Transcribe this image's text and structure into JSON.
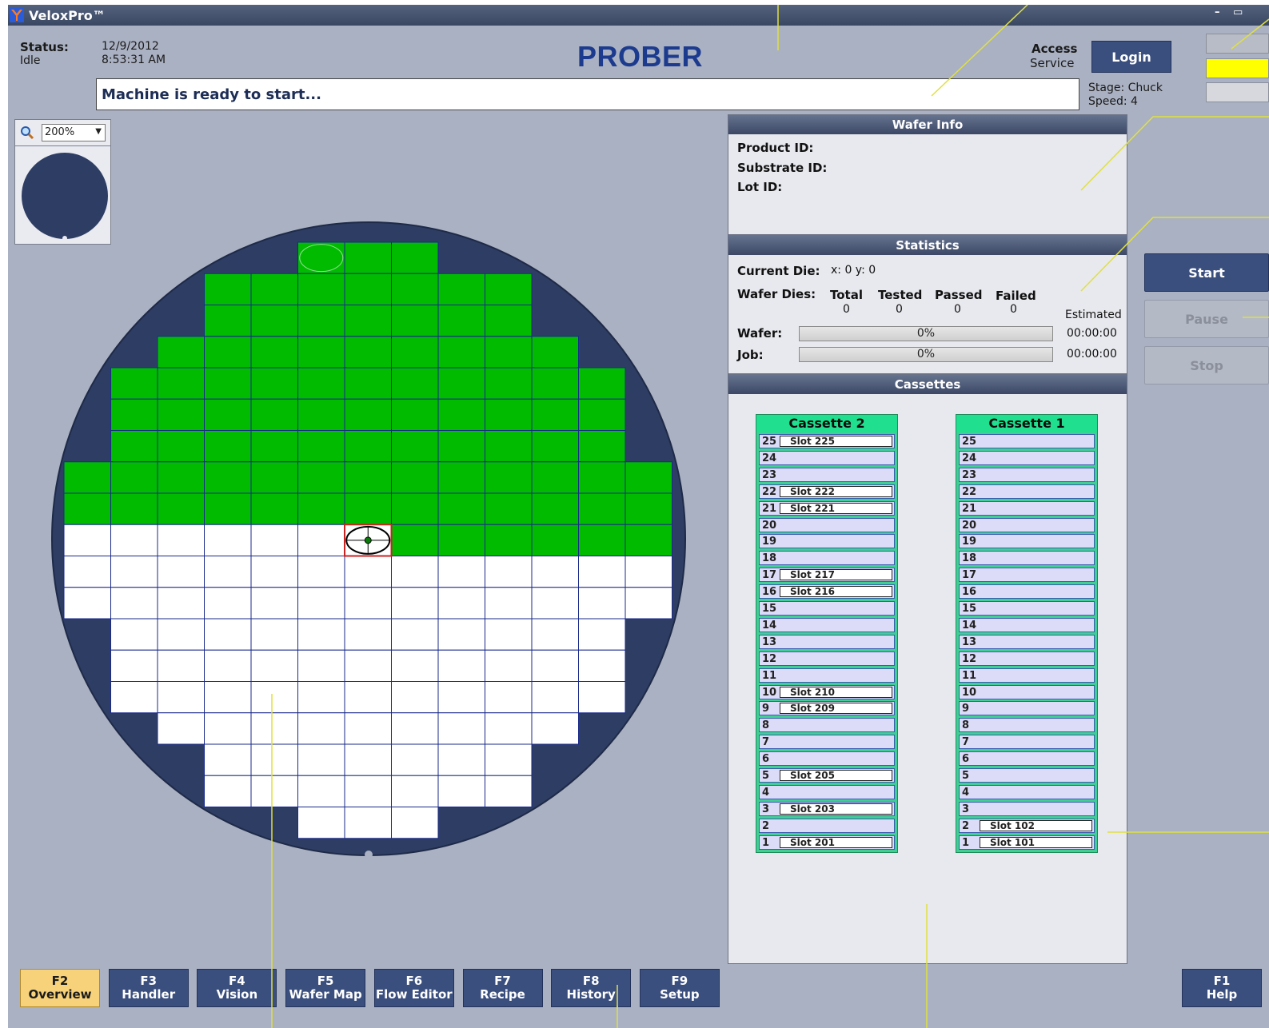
{
  "window": {
    "title": "VeloxPro™"
  },
  "header": {
    "status_label": "Status:",
    "status_value": "Idle",
    "date": "12/9/2012",
    "time": "8:53:31 AM",
    "app_heading": "PROBER",
    "access_label": "Access",
    "access_value": "Service",
    "login_label": "Login",
    "message": "Machine is ready to start...",
    "stage": "Stage: Chuck",
    "speed": "Speed: 4"
  },
  "indicators": [
    {
      "color": "#b8bcc6"
    },
    {
      "color": "#ffff00"
    },
    {
      "color": "#d6d8de"
    }
  ],
  "zoom": {
    "value": "200%"
  },
  "wafer_map": {
    "colors": {
      "wafer": "#2e3d63",
      "tested": "#00bb00",
      "untested": "#ffffff",
      "grid": "#1a2a8a",
      "current": "#cc2222"
    },
    "rows": [
      {
        "from": 5,
        "to": 7,
        "tested": [
          5,
          7
        ]
      },
      {
        "from": 3,
        "to": 9,
        "tested": [
          3,
          9
        ]
      },
      {
        "from": 3,
        "to": 9,
        "tested": [
          3,
          9
        ]
      },
      {
        "from": 2,
        "to": 10,
        "tested": [
          2,
          10
        ]
      },
      {
        "from": 1,
        "to": 11,
        "tested": [
          1,
          11
        ]
      },
      {
        "from": 1,
        "to": 11,
        "tested": [
          1,
          11
        ]
      },
      {
        "from": 1,
        "to": 11,
        "tested": [
          1,
          11
        ]
      },
      {
        "from": 0,
        "to": 12,
        "tested": [
          0,
          12
        ]
      },
      {
        "from": 0,
        "to": 12,
        "tested": [
          0,
          12
        ]
      },
      {
        "from": 0,
        "to": 12,
        "tested": [
          7,
          12
        ]
      },
      {
        "from": 0,
        "to": 12,
        "tested": null
      },
      {
        "from": 0,
        "to": 12,
        "tested": null
      },
      {
        "from": 1,
        "to": 11,
        "tested": null
      },
      {
        "from": 1,
        "to": 11,
        "tested": null
      },
      {
        "from": 1,
        "to": 11,
        "tested": null
      },
      {
        "from": 2,
        "to": 10,
        "tested": null
      },
      {
        "from": 3,
        "to": 9,
        "tested": null
      },
      {
        "from": 3,
        "to": 9,
        "tested": null
      },
      {
        "from": 5,
        "to": 7,
        "tested": null
      }
    ],
    "current_die": {
      "col": 6,
      "row": 9
    }
  },
  "wafer_info": {
    "title": "Wafer Info",
    "product_label": "Product ID:",
    "substrate_label": "Substrate ID:",
    "lot_label": "Lot ID:"
  },
  "statistics": {
    "title": "Statistics",
    "current_die_label": "Current Die:",
    "current_die_value": "x: 0   y: 0",
    "wafer_dies_label": "Wafer Dies:",
    "columns": [
      "Total",
      "Tested",
      "Passed",
      "Failed"
    ],
    "values": [
      "0",
      "0",
      "0",
      "0"
    ],
    "estimated_label": "Estimated",
    "wafer_label": "Wafer:",
    "wafer_progress": "0%",
    "wafer_time": "00:00:00",
    "job_label": "Job:",
    "job_progress": "0%",
    "job_time": "00:00:00"
  },
  "cassettes": {
    "title": "Cassettes",
    "list": [
      {
        "name": "Cassette 2",
        "slots": [
          {
            "num": "25",
            "name": "Slot  225"
          },
          {
            "num": "24",
            "name": ""
          },
          {
            "num": "23",
            "name": ""
          },
          {
            "num": "22",
            "name": "Slot  222"
          },
          {
            "num": "21",
            "name": "Slot  221"
          },
          {
            "num": "20",
            "name": ""
          },
          {
            "num": "19",
            "name": ""
          },
          {
            "num": "18",
            "name": ""
          },
          {
            "num": "17",
            "name": "Slot  217"
          },
          {
            "num": "16",
            "name": "Slot  216"
          },
          {
            "num": "15",
            "name": ""
          },
          {
            "num": "14",
            "name": ""
          },
          {
            "num": "13",
            "name": ""
          },
          {
            "num": "12",
            "name": ""
          },
          {
            "num": "11",
            "name": ""
          },
          {
            "num": "10",
            "name": "Slot  210"
          },
          {
            "num": "9",
            "name": "Slot  209"
          },
          {
            "num": "8",
            "name": ""
          },
          {
            "num": "7",
            "name": ""
          },
          {
            "num": "6",
            "name": ""
          },
          {
            "num": "5",
            "name": "Slot  205"
          },
          {
            "num": "4",
            "name": ""
          },
          {
            "num": "3",
            "name": "Slot  203"
          },
          {
            "num": "2",
            "name": ""
          },
          {
            "num": "1",
            "name": "Slot  201"
          }
        ]
      },
      {
        "name": "Cassette 1",
        "slots": [
          {
            "num": "25",
            "name": ""
          },
          {
            "num": "24",
            "name": ""
          },
          {
            "num": "23",
            "name": ""
          },
          {
            "num": "22",
            "name": ""
          },
          {
            "num": "21",
            "name": ""
          },
          {
            "num": "20",
            "name": ""
          },
          {
            "num": "19",
            "name": ""
          },
          {
            "num": "18",
            "name": ""
          },
          {
            "num": "17",
            "name": ""
          },
          {
            "num": "16",
            "name": ""
          },
          {
            "num": "15",
            "name": ""
          },
          {
            "num": "14",
            "name": ""
          },
          {
            "num": "13",
            "name": ""
          },
          {
            "num": "12",
            "name": ""
          },
          {
            "num": "11",
            "name": ""
          },
          {
            "num": "10",
            "name": ""
          },
          {
            "num": "9",
            "name": ""
          },
          {
            "num": "8",
            "name": ""
          },
          {
            "num": "7",
            "name": ""
          },
          {
            "num": "6",
            "name": ""
          },
          {
            "num": "5",
            "name": ""
          },
          {
            "num": "4",
            "name": ""
          },
          {
            "num": "3",
            "name": ""
          },
          {
            "num": "2",
            "name": "Slot  102"
          },
          {
            "num": "1",
            "name": "Slot  101"
          }
        ]
      }
    ]
  },
  "controls": {
    "start": "Start",
    "pause": "Pause",
    "stop": "Stop"
  },
  "function_keys": [
    {
      "key": "F2",
      "label": "Overview",
      "active": true
    },
    {
      "key": "F3",
      "label": "Handler"
    },
    {
      "key": "F4",
      "label": "Vision"
    },
    {
      "key": "F5",
      "label": "Wafer Map"
    },
    {
      "key": "F6",
      "label": "Flow Editor"
    },
    {
      "key": "F7",
      "label": "Recipe"
    },
    {
      "key": "F8",
      "label": "History"
    },
    {
      "key": "F9",
      "label": "Setup"
    }
  ],
  "help_key": {
    "key": "F1",
    "label": "Help"
  },
  "icons": [
    "app-logo-icon",
    "minimize-icon",
    "restore-icon",
    "magnifier-icon",
    "dropdown-arrow-icon"
  ]
}
